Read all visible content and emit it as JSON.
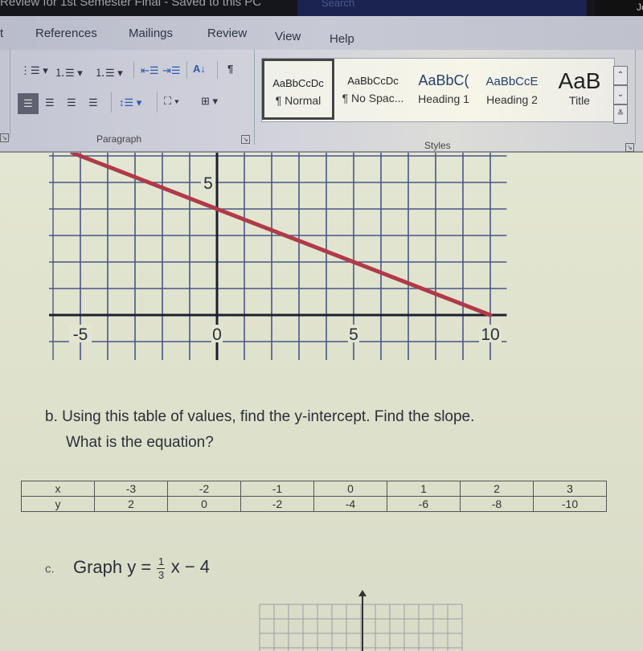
{
  "window": {
    "title_fragment": "Review for 1st Semester Final - Saved to this PC",
    "search_label": "Search",
    "user_initial": "Jo"
  },
  "ribbon": {
    "tabs": [
      "t",
      "References",
      "Mailings",
      "Review",
      "View",
      "Help"
    ],
    "paragraph_group": {
      "label": "Paragraph",
      "tools": [
        "bullets",
        "numbering",
        "multilevel-list",
        "decrease-indent",
        "increase-indent",
        "sort",
        "show-formatting-marks",
        "align-left",
        "center",
        "align-right",
        "justify",
        "line-spacing",
        "shading",
        "borders"
      ]
    },
    "styles_group": {
      "label": "Styles",
      "items": [
        {
          "preview": "AaBbCcDc",
          "name": "¶ Normal",
          "selected": true
        },
        {
          "preview": "AaBbCcDc",
          "name": "¶ No Spac...",
          "selected": false
        },
        {
          "preview": "AaBbC(",
          "name": "Heading 1",
          "selected": false
        },
        {
          "preview": "AaBbCcE",
          "name": "Heading 2",
          "selected": false
        },
        {
          "preview": "AaB",
          "name": "Title",
          "selected": false
        }
      ]
    }
  },
  "document": {
    "graph_a": {
      "chart_data": {
        "type": "line",
        "title": "",
        "xlabel": "",
        "ylabel": "",
        "x_tick_labels": [
          "-5",
          "0",
          "5",
          "10"
        ],
        "y_tick_labels": [
          "5"
        ],
        "xlim": [
          -6,
          10.5
        ],
        "ylim": [
          -1,
          6.3
        ],
        "grid": true,
        "series": [
          {
            "name": "line",
            "color": "#b03a48",
            "x": [
              -5.3,
              10
            ],
            "y": [
              6.12,
              0
            ]
          }
        ]
      }
    },
    "question_b": {
      "line1": "b. Using this table of values, find the y-intercept.  Find the slope.",
      "line2": "What is the equation?"
    },
    "table": {
      "x_label": "x",
      "y_label": "y",
      "x_values": [
        "-3",
        "-2",
        "-1",
        "0",
        "1",
        "2",
        "3"
      ],
      "y_values": [
        "2",
        "0",
        "-2",
        "-4",
        "-6",
        "-8",
        "-10"
      ]
    },
    "question_c": {
      "label": "c.",
      "text": "Graph y =",
      "frac_num": "1",
      "frac_den": "3",
      "rest": "x − 4"
    }
  }
}
